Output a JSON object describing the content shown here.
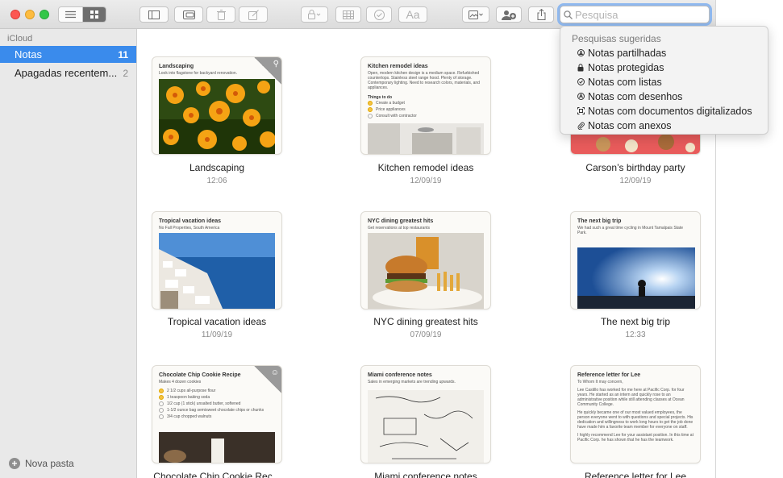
{
  "toolbar": {
    "search_placeholder": "Pesquisa",
    "font_button": "Aa"
  },
  "sidebar": {
    "header": "iCloud",
    "items": [
      {
        "label": "Notas",
        "count": "11"
      },
      {
        "label": "Apagadas recentem...",
        "count": "2"
      }
    ],
    "new_folder": "Nova pasta"
  },
  "search_suggestions": {
    "header": "Pesquisas sugeridas",
    "items": [
      {
        "label": "Notas partilhadas",
        "icon": "shared-person-icon"
      },
      {
        "label": "Notas protegidas",
        "icon": "lock-icon"
      },
      {
        "label": "Notas com listas",
        "icon": "checkmark-circle-icon"
      },
      {
        "label": "Notas com desenhos",
        "icon": "drawing-icon"
      },
      {
        "label": "Notas com documentos digitalizados",
        "icon": "scan-icon"
      },
      {
        "label": "Notas com anexos",
        "icon": "paperclip-icon"
      }
    ]
  },
  "notes": [
    {
      "title": "Landscaping",
      "date": "12:06",
      "preview_title": "Landscaping",
      "preview_text": "Look into flagstone for backyard renovation.",
      "pinned": true
    },
    {
      "title": "Kitchen remodel ideas",
      "date": "12/09/19",
      "preview_title": "Kitchen remodel ideas",
      "preview_text": "Open, modern kitchen design is a medium space. Refurbished countertops. Stainless steel range hood. Plenty of storage. Contemporary lighting. Need to research colors, materials, and appliances.",
      "checklist_title": "Things to do",
      "checklist": [
        {
          "text": "Create a budget",
          "done": true
        },
        {
          "text": "Price appliances",
          "done": true
        },
        {
          "text": "Consult with contractor",
          "done": false
        }
      ]
    },
    {
      "title": "Carson’s birthday party",
      "date": "12/09/19"
    },
    {
      "title": "Tropical vacation ideas",
      "date": "11/09/19",
      "preview_title": "Tropical vacation ideas",
      "preview_text": "No Fall Properties, South America"
    },
    {
      "title": "NYC dining greatest hits",
      "date": "07/09/19",
      "preview_title": "NYC dining greatest hits",
      "preview_text": "Get reservations at top restaurants"
    },
    {
      "title": "The next big trip",
      "date": "12:33",
      "preview_title": "The next big trip",
      "preview_text": "We had such a great time cycling in Mount Tamalpais State Park."
    },
    {
      "title": "Chocolate Chip Cookie Rec...",
      "date": "",
      "preview_title": "Chocolate Chip Cookie Recipe",
      "preview_text": "Makes 4 dozen cookies",
      "shared": true,
      "checklist": [
        {
          "text": "2 1/2 cups all-purpose flour",
          "done": true
        },
        {
          "text": "1 teaspoon baking soda",
          "done": true
        },
        {
          "text": "1/2 cup (1 stick) unsalted butter, softened",
          "done": false
        },
        {
          "text": "1-1/2 ounce bag semisweet chocolate chips or chunks",
          "done": false
        },
        {
          "text": "3/4 cup chopped walnuts",
          "done": false
        }
      ]
    },
    {
      "title": "Miami conference notes",
      "date": "",
      "preview_title": "Miami conference notes",
      "preview_text": "Sales in emerging markets are trending upwards."
    },
    {
      "title": "Reference letter for Lee",
      "date": "",
      "preview_title": "Reference letter for Lee",
      "preview_text": "To Whom It may concern,",
      "body": [
        "Lee Castillo has worked for me here at Pacific Corp. for four years. He started as an intern and quickly rose to an administrative position while still attending classes at Ocean Community College.",
        "He quickly became one of our most valued employees, the person everyone went to with questions and special projects. His dedication and willingness to work long hours to get the job done have made him a favorite team member for everyone on staff.",
        "I highly recommend Lee for your assistant position. In this time at Pacific Corp. he has shown that he has the teamwork."
      ]
    }
  ],
  "colors": {
    "selection": "#3a8bec",
    "search_focus": "#8fb8ee"
  }
}
